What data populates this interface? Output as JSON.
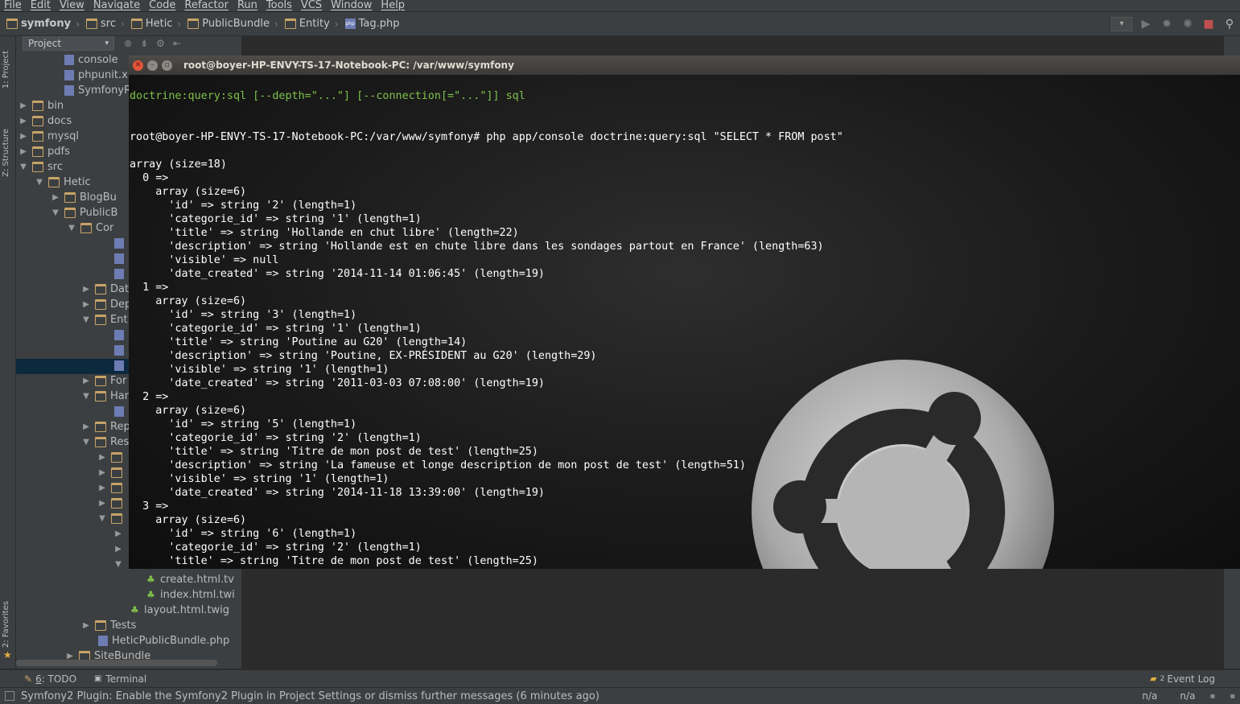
{
  "menu": [
    "File",
    "Edit",
    "View",
    "Navigate",
    "Code",
    "Refactor",
    "Run",
    "Tools",
    "VCS",
    "Window",
    "Help"
  ],
  "breadcrumb": [
    "symfony",
    "src",
    "Hetic",
    "PublicBundle",
    "Entity",
    "Tag.php"
  ],
  "left_strip": {
    "project": "1: Project",
    "structure": "Z: Structure",
    "favorites": "2: Favorites"
  },
  "project_panel": {
    "tab_label": "Project",
    "rows": [
      {
        "label": "console",
        "icon": "php-file-icon",
        "indent": 4,
        "arrow": ""
      },
      {
        "label": "phpunit.x",
        "icon": "php-file-icon",
        "indent": 4,
        "arrow": ""
      },
      {
        "label": "SymfonyR",
        "icon": "php-file-icon",
        "indent": 4,
        "arrow": ""
      },
      {
        "label": "bin",
        "icon": "folder-icon",
        "indent": 2,
        "arrow": "collapsed"
      },
      {
        "label": "docs",
        "icon": "folder-icon",
        "indent": 2,
        "arrow": "collapsed"
      },
      {
        "label": "mysql",
        "icon": "folder-icon",
        "indent": 2,
        "arrow": "collapsed"
      },
      {
        "label": "pdfs",
        "icon": "folder-icon",
        "indent": 2,
        "arrow": "collapsed"
      },
      {
        "label": "src",
        "icon": "folder-icon",
        "indent": 2,
        "arrow": "expanded"
      },
      {
        "label": "Hetic",
        "icon": "folder-icon",
        "indent": 3,
        "arrow": "expanded"
      },
      {
        "label": "BlogBu",
        "icon": "folder-icon",
        "indent": 4,
        "arrow": "collapsed"
      },
      {
        "label": "PublicB",
        "icon": "folder-icon",
        "indent": 4,
        "arrow": "expanded"
      },
      {
        "label": "Cor",
        "icon": "folder-icon",
        "indent": 5,
        "arrow": "expanded"
      }
    ],
    "rows2": [
      {
        "label": "Dat",
        "arrow": "collapsed"
      },
      {
        "label": "Dep",
        "arrow": "collapsed"
      },
      {
        "label": "Ent",
        "arrow": "expanded"
      }
    ],
    "rows3": [
      {
        "label": "For",
        "arrow": "collapsed"
      },
      {
        "label": "Han",
        "arrow": "expanded"
      }
    ],
    "rows4": [
      {
        "label": "Rep",
        "arrow": "collapsed"
      },
      {
        "label": "Res",
        "arrow": "expanded"
      }
    ],
    "twig_files": [
      "create.html.tv",
      "index.html.twi",
      "layout.html.twig"
    ],
    "tests": "Tests",
    "bundle_file": "HeticPublicBundle.php",
    "site_bundle": "SiteBundle"
  },
  "terminal": {
    "title": "root@boyer-HP-ENVY-TS-17-Notebook-PC: /var/www/symfony",
    "lines": [
      "doctrine:query:sql [--depth=\"...\"] [--connection[=\"...\"]] sql",
      "",
      "",
      "root@boyer-HP-ENVY-TS-17-Notebook-PC:/var/www/symfony# php app/console doctrine:query:sql \"SELECT * FROM post\"",
      "",
      "array (size=18)",
      "  0 =>",
      "    array (size=6)",
      "      'id' => string '2' (length=1)",
      "      'categorie_id' => string '1' (length=1)",
      "      'title' => string 'Hollande en chut libre' (length=22)",
      "      'description' => string 'Hollande est en chute libre dans les sondages partout en France' (length=63)",
      "      'visible' => null",
      "      'date_created' => string '2014-11-14 01:06:45' (length=19)",
      "  1 =>",
      "    array (size=6)",
      "      'id' => string '3' (length=1)",
      "      'categorie_id' => string '1' (length=1)",
      "      'title' => string 'Poutine au G20' (length=14)",
      "      'description' => string 'Poutine, EX-PRÉSIDENT au G20' (length=29)",
      "      'visible' => string '1' (length=1)",
      "      'date_created' => string '2011-03-03 07:08:00' (length=19)",
      "  2 =>",
      "    array (size=6)",
      "      'id' => string '5' (length=1)",
      "      'categorie_id' => string '2' (length=1)",
      "      'title' => string 'Titre de mon post de test' (length=25)",
      "      'description' => string 'La fameuse et longe description de mon post de test' (length=51)",
      "      'visible' => string '1' (length=1)",
      "      'date_created' => string '2014-11-18 13:39:00' (length=19)",
      "  3 =>",
      "    array (size=6)",
      "      'id' => string '6' (length=1)",
      "      'categorie_id' => string '2' (length=1)",
      "      'title' => string 'Titre de mon post de test' (length=25)"
    ]
  },
  "bottom_tools": {
    "todo_key": "6",
    "todo_label": ": TODO",
    "terminal": "Terminal",
    "event_log": "Event Log",
    "event_count": "2"
  },
  "status": {
    "message": "Symfony2 Plugin: Enable the Symfony2 Plugin in Project Settings or dismiss further messages (6 minutes ago)",
    "pos1": "n/a",
    "pos2": "n/a"
  },
  "colors": {
    "ide_bg": "#2b2b2b",
    "panel_bg": "#3c3f41",
    "terminal_text": "#ffffff",
    "terminal_green": "#7ec24b",
    "selection": "#0d293e"
  }
}
